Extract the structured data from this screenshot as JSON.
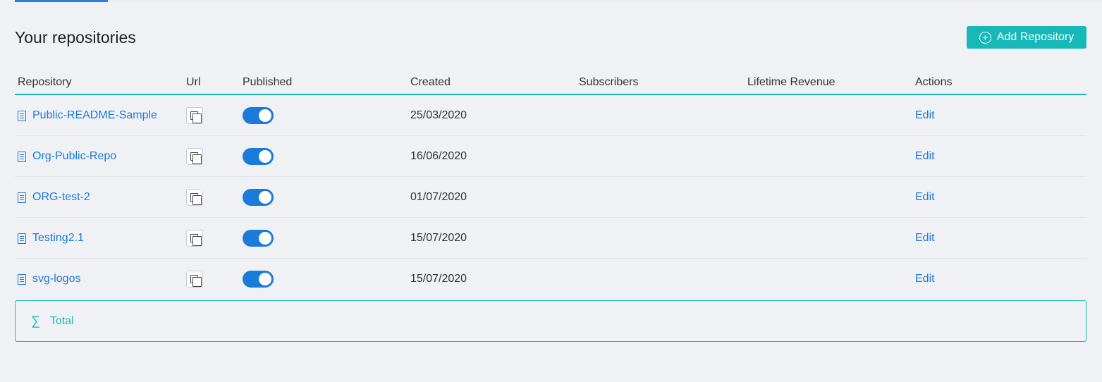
{
  "page": {
    "title": "Your repositories"
  },
  "toolbar": {
    "add_label": "Add Repository",
    "add_icon": "plus-circle-icon"
  },
  "table": {
    "headers": {
      "repository": "Repository",
      "url": "Url",
      "published": "Published",
      "created": "Created",
      "subscribers": "Subscribers",
      "revenue": "Lifetime Revenue",
      "actions": "Actions"
    },
    "rows": [
      {
        "name": "Public-README-Sample",
        "published": true,
        "created": "25/03/2020",
        "action": "Edit"
      },
      {
        "name": "Org-Public-Repo",
        "published": true,
        "created": "16/06/2020",
        "action": "Edit"
      },
      {
        "name": "ORG-test-2",
        "published": true,
        "created": "01/07/2020",
        "action": "Edit"
      },
      {
        "name": "Testing2.1",
        "published": true,
        "created": "15/07/2020",
        "action": "Edit"
      },
      {
        "name": "svg-logos",
        "published": true,
        "created": "15/07/2020",
        "action": "Edit"
      }
    ]
  },
  "total": {
    "label": "Total",
    "icon": "sigma-icon"
  },
  "colors": {
    "accent": "#17b8b8",
    "link": "#1a7bd8",
    "background": "#f0f1f5"
  }
}
